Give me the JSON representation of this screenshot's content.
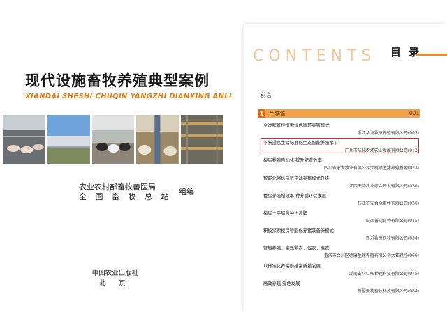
{
  "cover": {
    "title": "现代设施畜牧养殖典型案例",
    "pinyin": "XIANDAI SHESHI CHUQIN YANGZHI DIANXING ANLI",
    "authors": [
      "农业农村部畜牧兽医局",
      "全 国 畜 牧 总 站"
    ],
    "author_role": "组编",
    "publisher": "中国农业出版社",
    "city": "北 京",
    "photos": [
      "pig-pen-photo",
      "barn-exterior-photo",
      "cattle-barn-photo",
      "sheep-barn-photo",
      "poultry-cage-photo"
    ]
  },
  "contents": {
    "heading_en": "CONTENTS",
    "heading_cn": "目 录",
    "preface": "前言",
    "section": {
      "number": "1",
      "label": "生猪篇",
      "page": "001"
    },
    "entries": [
      {
        "title": "全过程管控探索绿色循环养殖模式",
        "org": "浙江华海牧原养殖有限公司(003)"
      },
      {
        "title": "不断提高生猪标准化生态智能养殖水平",
        "org": "广州市从化农场农业发展有限公司(012)"
      },
      {
        "title": "楼房养殖自动化  提升肥育效率",
        "org": "四川省蒙大牧业有限公司大树镇生猪养殖基地(023)"
      },
      {
        "title": "智能化猪场示范带动养殖模式升级",
        "org": "江西天韵农业综合开发有限公司(030)"
      },
      {
        "title": "楼房养殖增效率  种养循环促发展",
        "org": "枝江市安合众畜牧有限公司(036)"
      },
      {
        "title": "楼房＋平层育种＋育肥",
        "org": "山西普润育种有限公司(045)"
      },
      {
        "title": "积极探索楼房智能化养猪装备新模式",
        "org": "新沂牧原农牧有限公司(054)"
      },
      {
        "title": "智能养殖、高效繁农、促农、惠农",
        "org": "重庆市合川区德康生猪养殖有限公司太和猪场(066)"
      },
      {
        "title": "以标准化养猪助推高质量发展",
        "org": "湖南省众仁旺种猪科技有限公司(075)"
      },
      {
        "title": "高效养殖  绿色发展",
        "org": "新疆天物畜牧科技有限公司(084)"
      }
    ]
  }
}
